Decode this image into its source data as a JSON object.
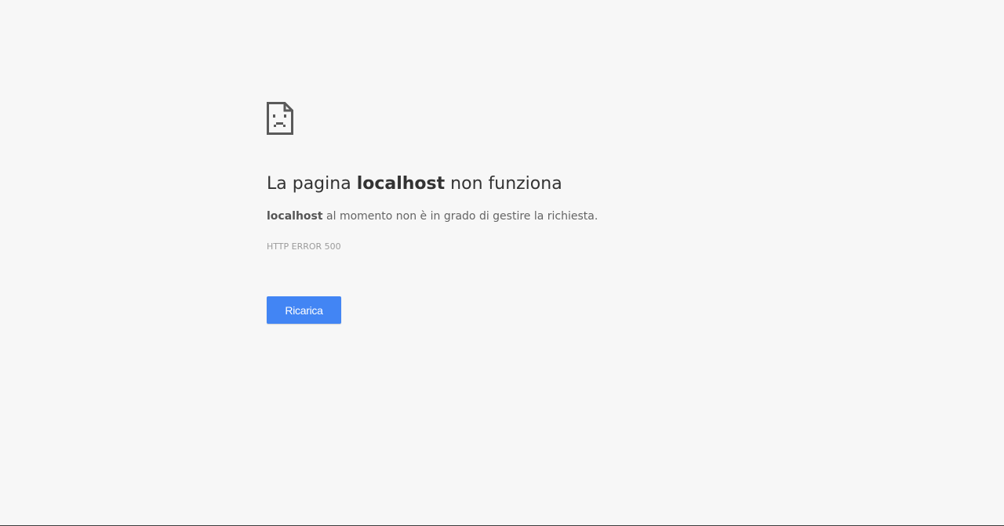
{
  "icon": "sad-page-icon",
  "heading": {
    "prefix": "La pagina ",
    "host": "localhost",
    "suffix": " non funziona"
  },
  "message": {
    "host": "localhost",
    "text": " al momento non è in grado di gestire la richiesta."
  },
  "error_code": "HTTP ERROR 500",
  "reload_button": {
    "label": "Ricarica"
  },
  "colors": {
    "background": "#f7f7f7",
    "button": "#4285f4",
    "heading": "#333333",
    "message": "#646464",
    "error_code": "#9b9b9b"
  }
}
